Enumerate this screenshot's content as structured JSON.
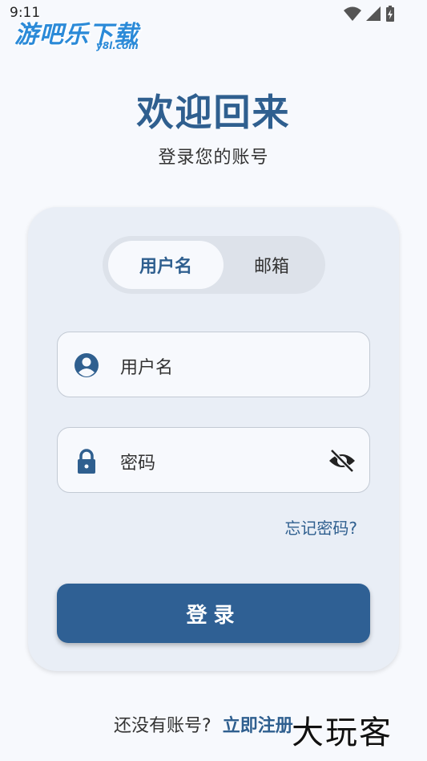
{
  "status_bar": {
    "time": "9:11"
  },
  "watermark_top": {
    "main": "游吧乐下载",
    "sub": "y8l.com"
  },
  "header": {
    "title": "欢迎回来",
    "subtitle": "登录您的账号"
  },
  "tabs": [
    {
      "label": "用户名",
      "active": true
    },
    {
      "label": "邮箱",
      "active": false
    }
  ],
  "form": {
    "username_placeholder": "用户名",
    "password_placeholder": "密码",
    "forgot_label": "忘记密码?",
    "submit_label": "登录"
  },
  "footer": {
    "question": "还没有账号?",
    "register_label": "立即注册"
  },
  "watermark_bottom": "大玩客",
  "colors": {
    "accent": "#2f6094",
    "card_bg": "#e9eef6",
    "page_bg": "#f7f9fd"
  }
}
